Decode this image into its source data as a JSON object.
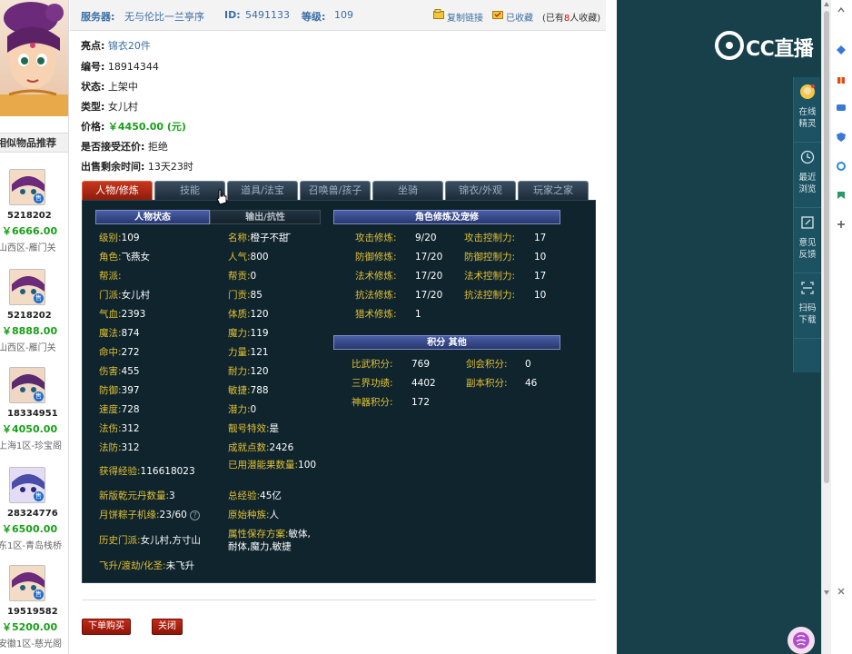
{
  "seller_info": {
    "server_label": "服务器:",
    "server_value": "无与伦比一兰亭序",
    "id_label": "ID:",
    "id_value": "5491133",
    "level_label": "等级:",
    "level_value": "109",
    "copy_link": "复制链接",
    "favorited": "已收藏",
    "fav_prefix": "(已有",
    "fav_count": "8",
    "fav_suffix": "人收藏)"
  },
  "details": {
    "highlight_label": "亮点:",
    "highlight_value": "锦衣20件",
    "serial_label": "编号:",
    "serial_value": "18914344",
    "status_label": "状态:",
    "status_value": "上架中",
    "type_label": "类型:",
    "type_value": "女儿村",
    "price_label": "价格:",
    "price_value": "￥4450.00 (元)",
    "counteroffer_label": "是否接受还价:",
    "counteroffer_value": "拒绝",
    "remaining_label": "出售剩余时间:",
    "remaining_value": "13天23时"
  },
  "tabs": [
    "人物/修炼",
    "技能",
    "道具/法宝",
    "召唤兽/孩子",
    "坐骑",
    "锦衣/外观",
    "玩家之家"
  ],
  "sections": {
    "char_status": "人物状态",
    "output_resist": "输出/抗性",
    "cultivation": "角色修炼及宠修",
    "points_other": "积分 其他"
  },
  "stats_left": [
    {
      "k": "级别:",
      "v": "109"
    },
    {
      "k": "角色:",
      "v": "飞燕女"
    },
    {
      "k": "帮派:",
      "v": ""
    },
    {
      "k": "门派:",
      "v": "女儿村"
    },
    {
      "k": "气血:",
      "v": "2393"
    },
    {
      "k": "魔法:",
      "v": "874"
    },
    {
      "k": "命中:",
      "v": "272"
    },
    {
      "k": "伤害:",
      "v": "455"
    },
    {
      "k": "防御:",
      "v": "397"
    },
    {
      "k": "速度:",
      "v": "728"
    },
    {
      "k": "法伤:",
      "v": "312"
    },
    {
      "k": "法防:",
      "v": "312"
    }
  ],
  "stats_right": [
    {
      "k": "名称:",
      "v": "橙子不甜 ̄"
    },
    {
      "k": "人气:",
      "v": "800"
    },
    {
      "k": "帮贡:",
      "v": "0"
    },
    {
      "k": "门贡:",
      "v": "85"
    },
    {
      "k": "体质:",
      "v": "120"
    },
    {
      "k": "魔力:",
      "v": "119"
    },
    {
      "k": "力量:",
      "v": "121"
    },
    {
      "k": "耐力:",
      "v": "120"
    },
    {
      "k": "敏捷:",
      "v": "788"
    },
    {
      "k": "潜力:",
      "v": "0"
    },
    {
      "k": "靓号特效:",
      "v": "是"
    },
    {
      "k": "成就点数:",
      "v": "2426"
    }
  ],
  "stats_bottom": {
    "exp_k": "获得经验:",
    "exp_v": "116618023",
    "potential_k": "已用潜能果数量:",
    "potential_v": "100",
    "qiankun_k": "新版乾元丹数量:",
    "qiankun_v": "3",
    "total_exp_k": "总经验:",
    "total_exp_v": "45亿",
    "mooncake_k": "月饼粽子机缘:",
    "mooncake_v": "23/60",
    "race_k": "原始种族:",
    "race_v": "人",
    "history_k": "历史门派:",
    "history_v": "女儿村,方寸山",
    "save_k": "属性保存方案:",
    "save_v": "敏体,耐体,魔力,敏捷",
    "ascend_k": "飞升/渡劫/化圣:",
    "ascend_v": "未飞升",
    "help_glyph": "?"
  },
  "cultivation": [
    {
      "k": "攻击修炼:",
      "v": "9/20",
      "k2": "攻击控制力:",
      "v2": "17"
    },
    {
      "k": "防御修炼:",
      "v": "17/20",
      "k2": "防御控制力:",
      "v2": "10"
    },
    {
      "k": "法术修炼:",
      "v": "17/20",
      "k2": "法术控制力:",
      "v2": "17"
    },
    {
      "k": "抗法修炼:",
      "v": "17/20",
      "k2": "抗法控制力:",
      "v2": "10"
    },
    {
      "k": "猎术修炼:",
      "v": "1",
      "k2": "",
      "v2": ""
    }
  ],
  "points": [
    {
      "k": "比武积分:",
      "v": "769",
      "k2": "剑会积分:",
      "v2": "0"
    },
    {
      "k": "三界功绩:",
      "v": "4402",
      "k2": "副本积分:",
      "v2": "46"
    },
    {
      "k": "神器积分:",
      "v": "172",
      "k2": "",
      "v2": ""
    }
  ],
  "actions": {
    "buy": "下单购买",
    "close": "关闭"
  },
  "sidebar": {
    "title": "相似物品推荐",
    "badge": "售",
    "items": [
      {
        "id": "5218202",
        "price": "￥6666.00",
        "server": "山西区-雁门关"
      },
      {
        "id": "5218202",
        "price": "￥8888.00",
        "server": "山西区-雁门关"
      },
      {
        "id": "18334951",
        "price": "￥4050.00",
        "server": "上海1区-珍宝阁"
      },
      {
        "id": "28324776",
        "price": "￥6500.00",
        "server": "东1区-青岛栈桥"
      },
      {
        "id": "19519582",
        "price": "￥5200.00",
        "server": "安徽1区-慈光阁"
      }
    ]
  },
  "stream": {
    "logo_text": "CC直播",
    "tools": [
      {
        "label": "在线精灵",
        "icon": "avatar-icon"
      },
      {
        "label": "最近浏览",
        "icon": "clock-icon"
      },
      {
        "label": "意见反馈",
        "icon": "edit-icon"
      },
      {
        "label": "扫码下载",
        "icon": "scan-icon"
      }
    ]
  },
  "colors": {
    "accent_blue": "#3b6ea5",
    "price_green": "#18a018",
    "stat_key_yellow": "#e2c035",
    "panel_dark": "#0f242d",
    "tab_active_red": "#c8361e",
    "stream_teal": "#17404b"
  }
}
